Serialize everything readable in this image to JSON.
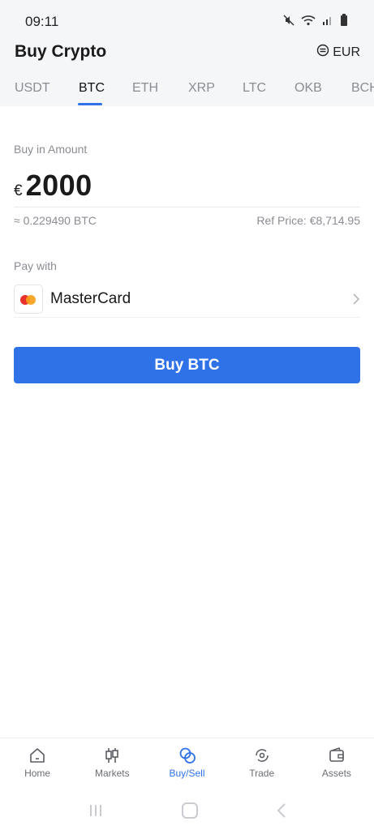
{
  "status_bar": {
    "time": "09:11"
  },
  "header": {
    "title": "Buy Crypto",
    "currency": "EUR"
  },
  "tabs": [
    {
      "label": "USDT"
    },
    {
      "label": "BTC",
      "active": true
    },
    {
      "label": "ETH"
    },
    {
      "label": "XRP"
    },
    {
      "label": "LTC"
    },
    {
      "label": "OKB"
    },
    {
      "label": "BCH"
    }
  ],
  "form": {
    "amount_label": "Buy in Amount",
    "amount_symbol": "€",
    "amount_value": "2000",
    "conversion": "≈ 0.229490 BTC",
    "ref_price": "Ref Price: €8,714.95",
    "pay_label": "Pay with",
    "pay_method": "MasterCard",
    "buy_button": "Buy BTC"
  },
  "bottom_nav": [
    {
      "label": "Home",
      "icon": "home-icon"
    },
    {
      "label": "Markets",
      "icon": "candlestick-icon"
    },
    {
      "label": "Buy/Sell",
      "icon": "coins-icon",
      "active": true
    },
    {
      "label": "Trade",
      "icon": "trade-icon"
    },
    {
      "label": "Assets",
      "icon": "wallet-icon"
    }
  ],
  "colors": {
    "accent": "#2f72e8",
    "mastercard_red": "#e8302c",
    "mastercard_orange": "#f8a11b"
  }
}
